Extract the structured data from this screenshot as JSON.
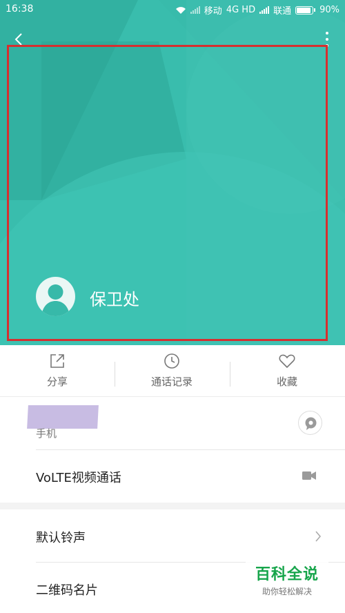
{
  "status_bar": {
    "time": "16:38",
    "carrier1": "移动",
    "network": "4G HD",
    "carrier2": "联通",
    "battery": "90%"
  },
  "header": {
    "back_icon": "chevron-left-icon",
    "more_icon": "more-vertical-icon",
    "contact_name": "保卫处",
    "accent_color": "#37b9a9",
    "highlight_color": "#d62f2f"
  },
  "actions": [
    {
      "label": "分享",
      "icon": "share-icon"
    },
    {
      "label": "通话记录",
      "icon": "clock-icon"
    },
    {
      "label": "收藏",
      "icon": "heart-icon"
    }
  ],
  "phone": {
    "label": "手机",
    "icon": "message-icon"
  },
  "volte": {
    "title": "VoLTE视频通话",
    "icon": "video-camera-icon"
  },
  "ringtone": {
    "title": "默认铃声",
    "icon": "chevron-right-icon"
  },
  "qr": {
    "title": "二维码名片"
  },
  "watermark": {
    "title": "百科全说",
    "subtitle": "助你轻松解决"
  }
}
